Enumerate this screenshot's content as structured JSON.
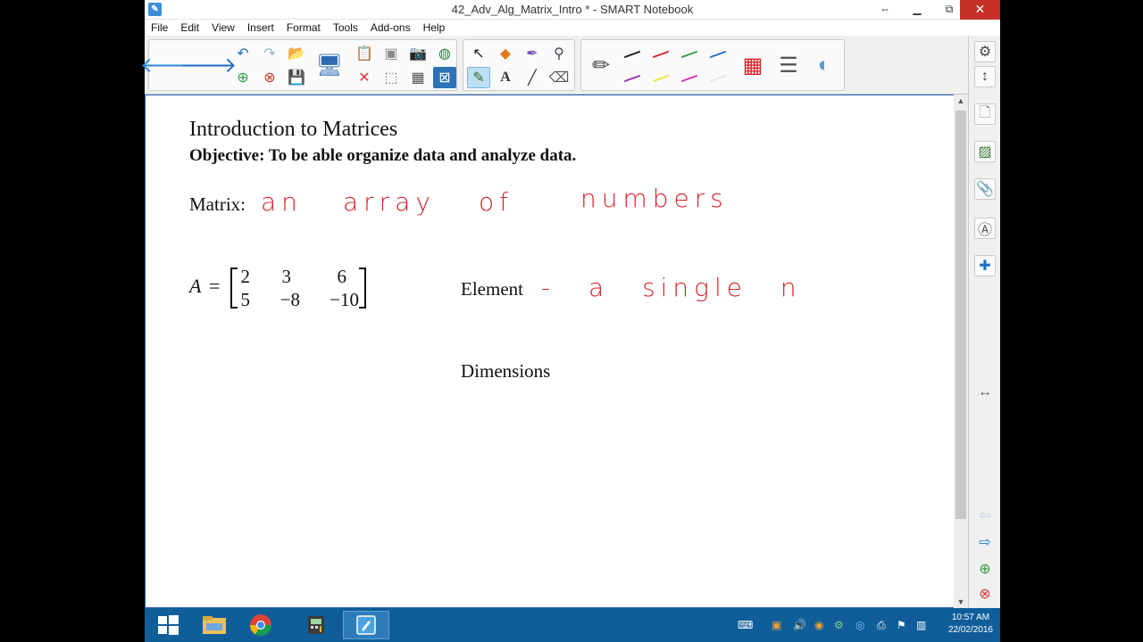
{
  "window": {
    "title": "42_Adv_Alg_Matrix_Intro * - SMART Notebook",
    "minimize": "▁",
    "restore": "⧉",
    "close": "✕",
    "resize": "⇔"
  },
  "menu": [
    "File",
    "Edit",
    "View",
    "Insert",
    "Format",
    "Tools",
    "Add-ons",
    "Help"
  ],
  "page": {
    "title": "Introduction to Matrices",
    "objective": "Objective: To be able organize data and analyze data.",
    "matrix_label": "Matrix:",
    "matrix_handwriting": [
      "an",
      "array",
      "of",
      "numbers"
    ],
    "matrix_name": "A",
    "matrix_equals": "=",
    "matrix_rows": [
      [
        "2",
        "3",
        "6"
      ],
      [
        "5",
        "−8",
        "−10"
      ]
    ],
    "element_label": "Element",
    "element_handwriting": "- a single n",
    "dimensions_label": "Dimensions"
  },
  "taskbar": {
    "time": "10:57 AM",
    "date": "22/02/2016"
  },
  "colors": {
    "ink_red": "#d8232a",
    "taskbar": "#0f5e9a",
    "accent_blue": "#1e7bd8"
  }
}
